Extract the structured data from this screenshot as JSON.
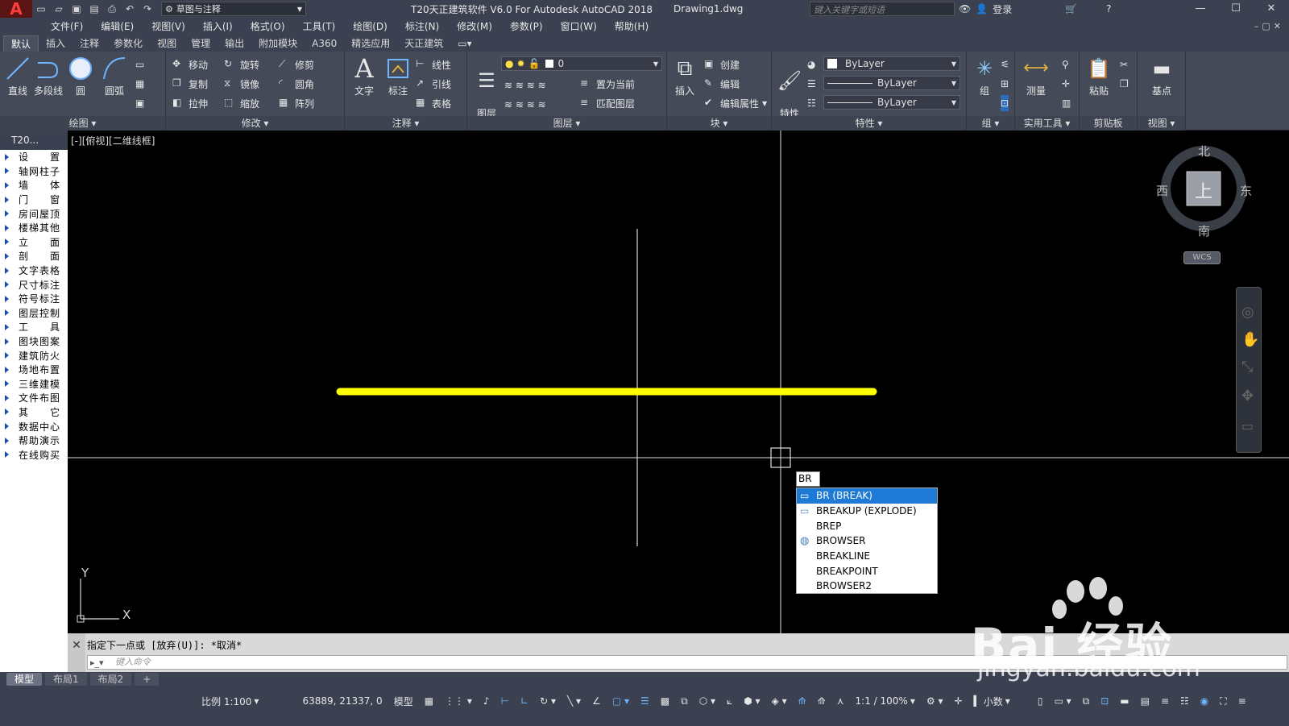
{
  "title_bar": {
    "logo": "A",
    "workspace": "草图与注释",
    "app_title": "T20天正建筑软件 V6.0 For Autodesk AutoCAD 2018",
    "doc_name": "Drawing1.dwg",
    "search_placeholder": "键入关键字或短语",
    "login": "登录"
  },
  "menu": [
    "文件(F)",
    "编辑(E)",
    "视图(V)",
    "插入(I)",
    "格式(O)",
    "工具(T)",
    "绘图(D)",
    "标注(N)",
    "修改(M)",
    "参数(P)",
    "窗口(W)",
    "帮助(H)"
  ],
  "ribbon_tabs": [
    "默认",
    "插入",
    "注释",
    "参数化",
    "视图",
    "管理",
    "输出",
    "附加模块",
    "A360",
    "精选应用",
    "天正建筑"
  ],
  "ribbon": {
    "draw": {
      "title": "绘图",
      "tools": [
        "直线",
        "多段线",
        "圆",
        "圆弧"
      ]
    },
    "modify": {
      "title": "修改",
      "tools": [
        "移动",
        "旋转",
        "修剪",
        "复制",
        "镜像",
        "圆角",
        "拉伸",
        "缩放",
        "阵列"
      ]
    },
    "annotation": {
      "title": "注释",
      "tools": [
        "文字",
        "标注",
        "线性",
        "引线",
        "表格"
      ]
    },
    "layers": {
      "title": "图层",
      "props": "图层\n特性",
      "layer_value": "0",
      "set_current": "置为当前",
      "match": "匹配图层"
    },
    "block": {
      "title": "块",
      "insert": "插入",
      "create": "创建",
      "edit": "编辑",
      "edit_attr": "编辑属性"
    },
    "properties": {
      "title": "特性",
      "match": "特性\n匹配",
      "color": "ByLayer",
      "linetype": "ByLayer",
      "lineweight": "ByLayer"
    },
    "group": {
      "title": "组",
      "label": "组"
    },
    "utilities": {
      "title": "实用工具",
      "measure": "测量"
    },
    "clipboard": {
      "title": "剪贴板",
      "paste": "粘贴"
    },
    "view": {
      "title": "视图",
      "base": "基点"
    }
  },
  "palette": {
    "header": "T20...",
    "items": [
      "设置",
      "轴网柱子",
      "墙体",
      "门窗",
      "房间屋顶",
      "楼梯其他",
      "立面",
      "剖面",
      "文字表格",
      "尺寸标注",
      "符号标注",
      "图层控制",
      "工具",
      "图块图案",
      "建筑防火",
      "场地布置",
      "三维建模",
      "文件布图",
      "其它",
      "数据中心",
      "帮助演示",
      "在线购买"
    ]
  },
  "canvas": {
    "view_label": "[-][俯视][二维线框]",
    "ucs_x": "X",
    "ucs_y": "Y"
  },
  "viewcube": {
    "north": "北",
    "south": "南",
    "east": "东",
    "west": "西",
    "top": "上",
    "wcs": "WCS"
  },
  "autocomplete": {
    "input": "BR",
    "items": [
      "BR (BREAK)",
      "BREAKUP (EXPLODE)",
      "BREP",
      "BROWSER",
      "BREAKLINE",
      "BREAKPOINT",
      "BROWSER2"
    ],
    "selected_index": 0
  },
  "command_line": {
    "history": "指定下一点或 [放弃(U)]: *取消*",
    "placeholder": "键入命令"
  },
  "layout_tabs": [
    "模型",
    "布局1",
    "布局2",
    "+"
  ],
  "status_bar": {
    "scale": "比例 1:100",
    "coords": "63889, 21337, 0",
    "space": "模型",
    "annotation_scale": "1:1 / 100%",
    "units": "小数"
  },
  "watermark": {
    "brand": "Bai 经验",
    "url": "jingyan.baidu.com"
  },
  "colors": {
    "drawn_line": "#ffff00",
    "canvas_bg": "#000000",
    "selection": "#1e7ad4"
  }
}
